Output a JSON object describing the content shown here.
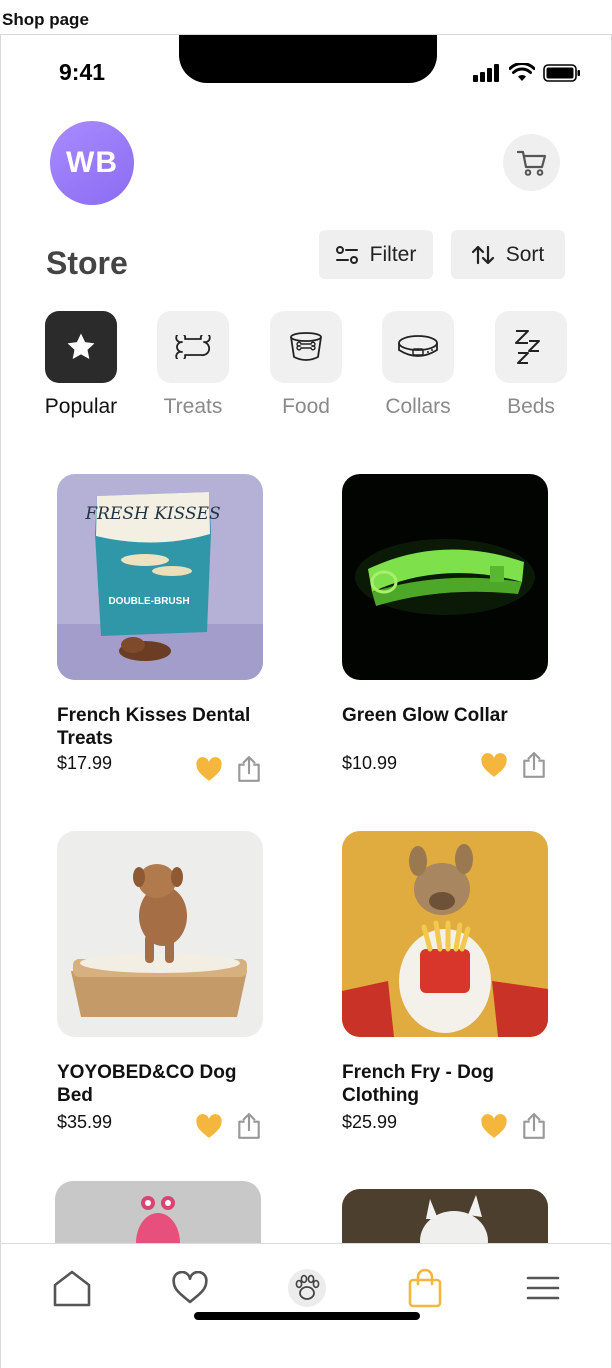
{
  "page_label": "Shop page",
  "status_bar": {
    "time": "9:41"
  },
  "header": {
    "avatar_initials": "WB",
    "title": "Store"
  },
  "toolbar": {
    "filter_label": "Filter",
    "sort_label": "Sort"
  },
  "categories": [
    {
      "label": "Popular",
      "icon": "star-icon",
      "active": true
    },
    {
      "label": "Treats",
      "icon": "bone-icon",
      "active": false
    },
    {
      "label": "Food",
      "icon": "food-bowl-icon",
      "active": false
    },
    {
      "label": "Collars",
      "icon": "collar-icon",
      "active": false
    },
    {
      "label": "Beds",
      "icon": "sleep-zzz-icon",
      "active": false
    }
  ],
  "products": [
    {
      "name": "French Kisses Dental Treats",
      "price": "$17.99",
      "favorited": true
    },
    {
      "name": "Green Glow Collar",
      "price": "$10.99",
      "favorited": true
    },
    {
      "name": "YOYOBED&CO Dog Bed",
      "price": "$35.99",
      "favorited": true
    },
    {
      "name": "French Fry - Dog Clothing",
      "price": "$25.99",
      "favorited": true
    }
  ],
  "package_text": {
    "brand": "FRESH KISSES",
    "variant": "DOUBLE-BRUSH"
  },
  "tab_bar": [
    {
      "icon": "home-icon",
      "active": false
    },
    {
      "icon": "heart-icon",
      "active": false
    },
    {
      "icon": "paw-icon",
      "active": false
    },
    {
      "icon": "shopping-bag-icon",
      "active": true
    },
    {
      "icon": "menu-icon",
      "active": false
    }
  ],
  "colors": {
    "accent": "#F4B63C",
    "avatar": "#9B7CFA",
    "active_category": "#2B2B2B"
  }
}
